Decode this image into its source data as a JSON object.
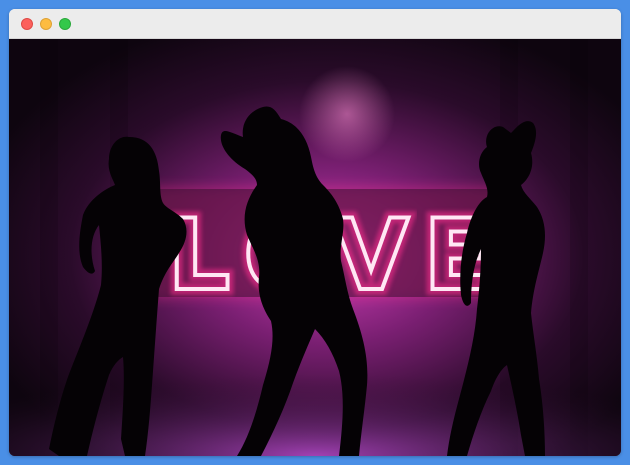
{
  "window": {
    "controls": {
      "close_icon": "close-dot-icon",
      "minimize_icon": "minimize-dot-icon",
      "maximize_icon": "maximize-dot-icon"
    },
    "colors": {
      "frame": "#4a8fe6",
      "titlebar": "#ececec",
      "close": "#fc605c",
      "minimize": "#fdbc40",
      "maximize": "#34c84a"
    }
  },
  "image": {
    "neon_sign": {
      "letters": [
        "L",
        "O",
        "V",
        "E"
      ],
      "color": "#ff2f8f"
    }
  }
}
